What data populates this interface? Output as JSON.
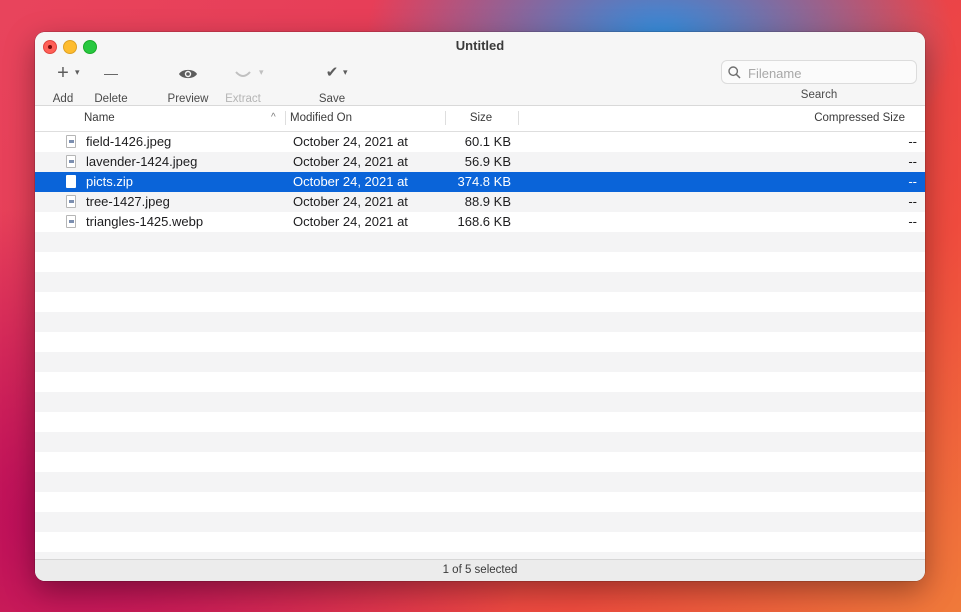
{
  "window": {
    "title": "Untitled"
  },
  "toolbar": {
    "add_label": "Add",
    "add_icon": "+",
    "delete_label": "Delete",
    "delete_icon": "—",
    "preview_label": "Preview",
    "extract_label": "Extract",
    "save_label": "Save",
    "save_icon": "✔",
    "caret": "▾"
  },
  "search": {
    "placeholder": "Filename",
    "label": "Search"
  },
  "columns": {
    "name": "Name",
    "sort_indicator": "^",
    "modified": "Modified On",
    "size": "Size",
    "compressed": "Compressed Size"
  },
  "files": [
    {
      "name": "field-1426.jpeg",
      "modified": "October 24, 2021 at",
      "size": "60.1 KB",
      "compressed": "--"
    },
    {
      "name": "lavender-1424.jpeg",
      "modified": "October 24, 2021 at",
      "size": "56.9 KB",
      "compressed": "--"
    },
    {
      "name": "picts.zip",
      "modified": "October 24, 2021 at",
      "size": "374.8 KB",
      "compressed": "--",
      "selected": true
    },
    {
      "name": "tree-1427.jpeg",
      "modified": "October 24, 2021 at",
      "size": "88.9 KB",
      "compressed": "--"
    },
    {
      "name": "triangles-1425.webp",
      "modified": "October 24, 2021 at",
      "size": "168.6 KB",
      "compressed": "--"
    }
  ],
  "status": {
    "text": "1 of 5 selected"
  },
  "colors": {
    "selection": "#0a64d9",
    "close": "#ff5f57",
    "minimize": "#febc2e",
    "maximize": "#28c840"
  }
}
